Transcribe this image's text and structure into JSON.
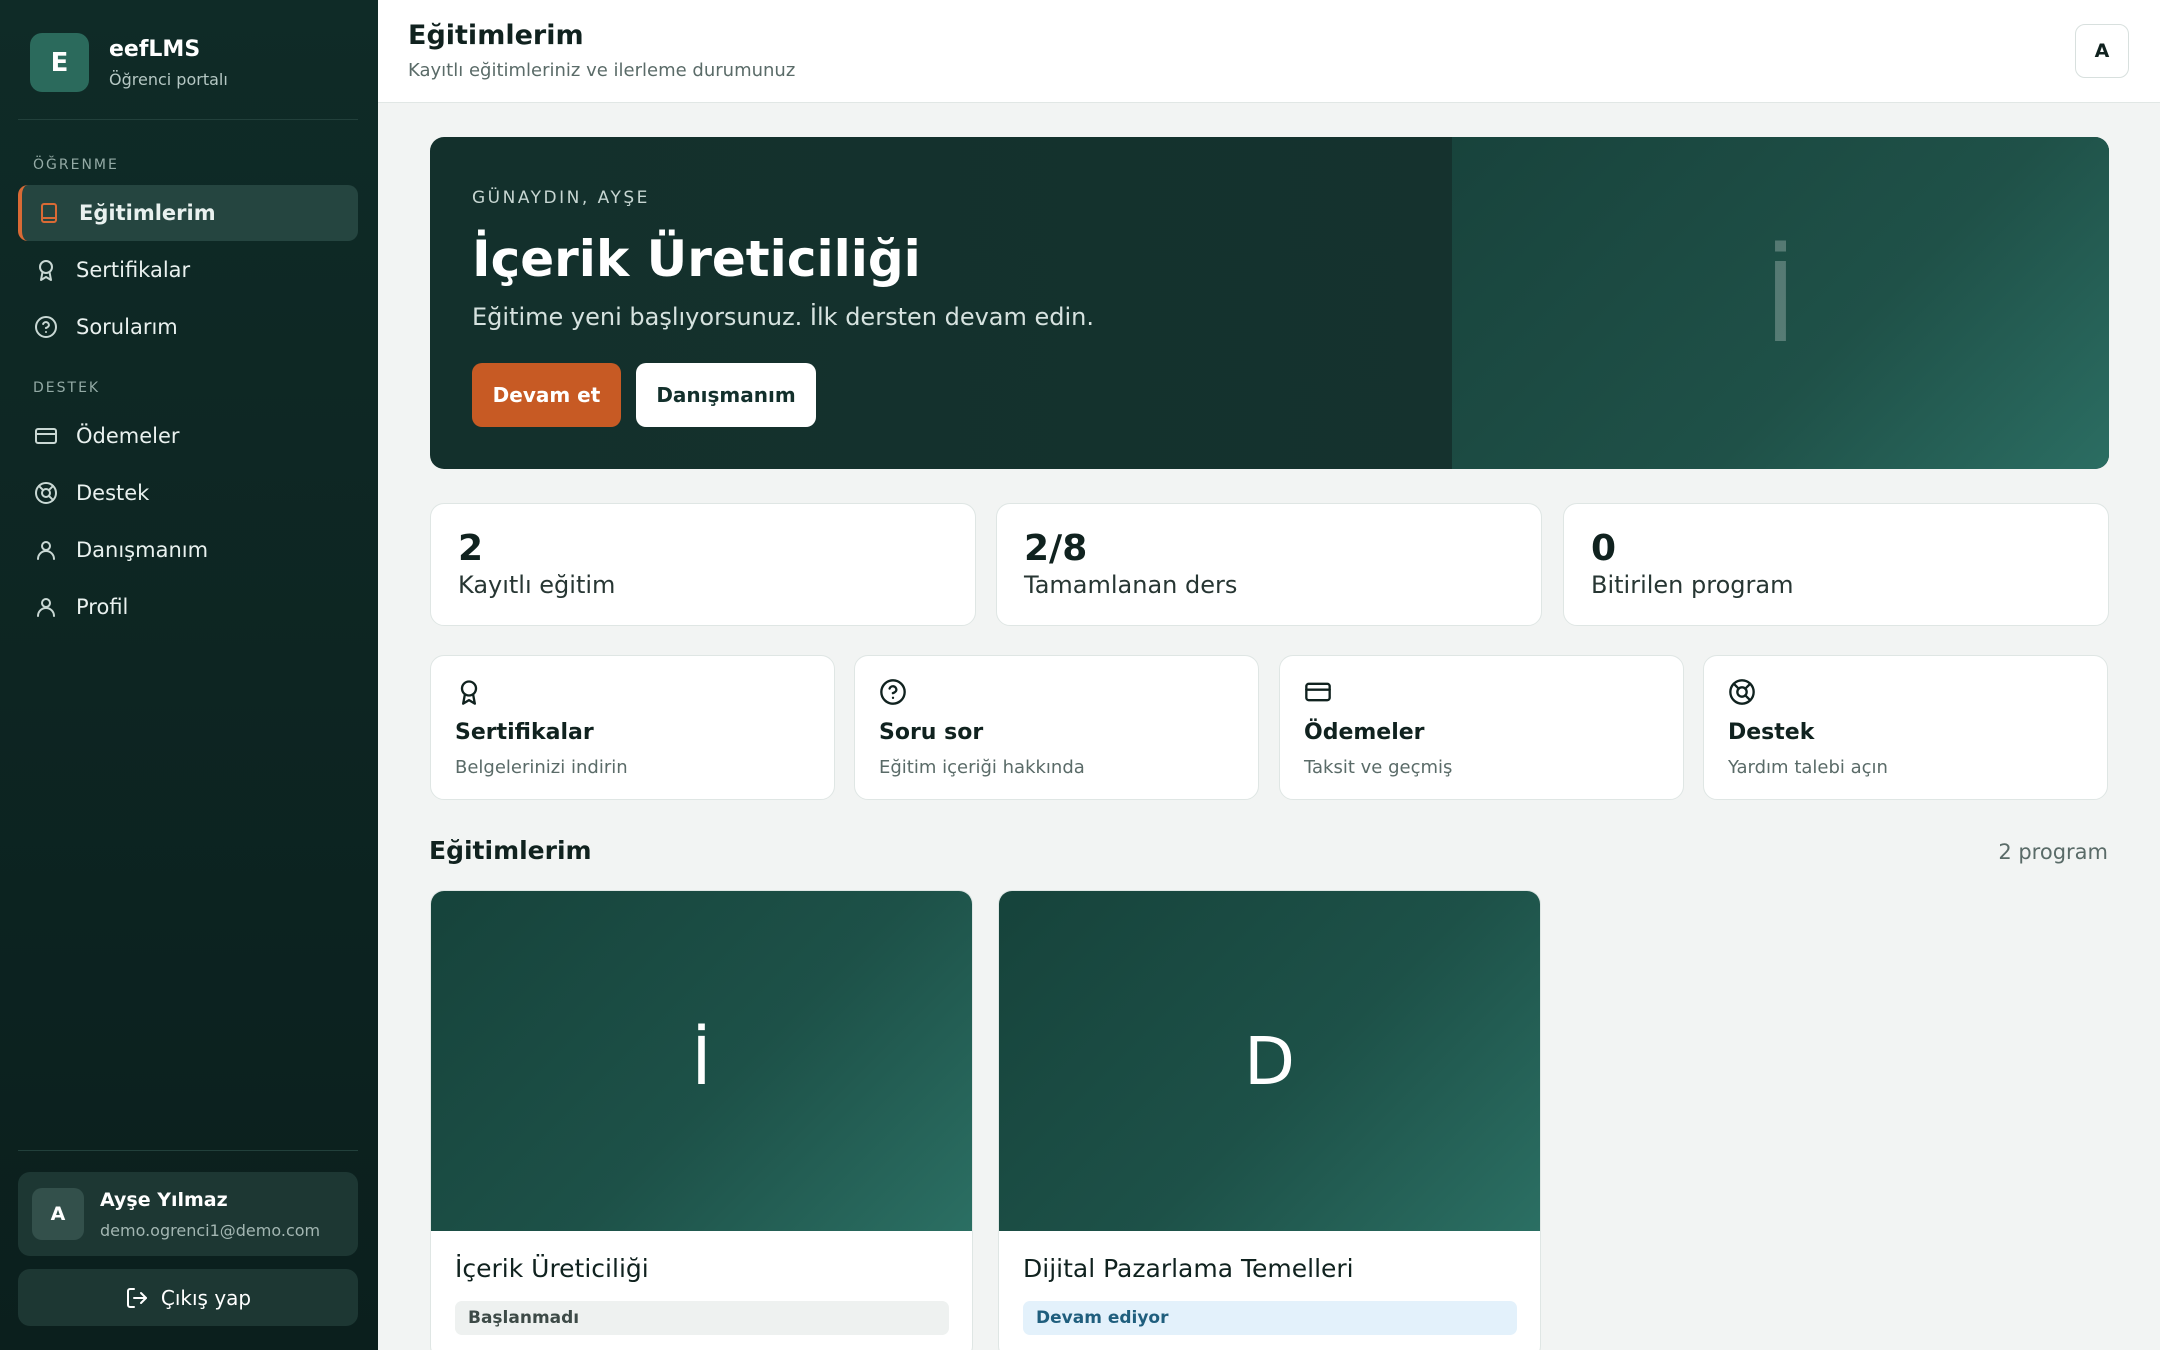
{
  "brand": {
    "logo_letter": "E",
    "name": "eefLMS",
    "subtitle": "Öğrenci portalı"
  },
  "sidebar": {
    "sections": [
      {
        "label": "ÖĞRENME"
      },
      {
        "label": "DESTEK"
      }
    ],
    "items": [
      {
        "label": "Eğitimlerim",
        "icon": "book-icon",
        "active": true
      },
      {
        "label": "Sertifikalar",
        "icon": "award-icon"
      },
      {
        "label": "Sorularım",
        "icon": "question-circle-icon"
      },
      {
        "label": "Ödemeler",
        "icon": "credit-card-icon"
      },
      {
        "label": "Destek",
        "icon": "life-buoy-icon"
      },
      {
        "label": "Danışmanım",
        "icon": "user-icon"
      },
      {
        "label": "Profil",
        "icon": "user-icon"
      }
    ]
  },
  "user": {
    "initial": "A",
    "name": "Ayşe Yılmaz",
    "email": "demo.ogrenci1@demo.com"
  },
  "logout_label": "Çıkış yap",
  "header": {
    "title": "Eğitimlerim",
    "subtitle": "Kayıtlı eğitimleriniz ve ilerleme durumunuz",
    "avatar": "A"
  },
  "hero": {
    "greeting": "GÜNAYDIN, AYŞE",
    "title": "İçerik Üreticiliği",
    "description": "Eğitime yeni başlıyorsunuz. İlk dersten devam edin.",
    "primary_button": "Devam et",
    "secondary_button": "Danışmanım",
    "thumb_letter": "İ"
  },
  "stats": [
    {
      "value": "2",
      "label": "Kayıtlı eğitim"
    },
    {
      "value": "2/8",
      "label": "Tamamlanan ders"
    },
    {
      "value": "0",
      "label": "Bitirilen program"
    }
  ],
  "quick_links": [
    {
      "title": "Sertifikalar",
      "subtitle": "Belgelerinizi indirin",
      "icon": "award-icon"
    },
    {
      "title": "Soru sor",
      "subtitle": "Eğitim içeriği hakkında",
      "icon": "question-circle-icon"
    },
    {
      "title": "Ödemeler",
      "subtitle": "Taksit ve geçmiş",
      "icon": "credit-card-icon"
    },
    {
      "title": "Destek",
      "subtitle": "Yardım talebi açın",
      "icon": "life-buoy-icon"
    }
  ],
  "courses_section": {
    "title": "Eğitimlerim",
    "count": "2 program"
  },
  "courses": [
    {
      "letter": "İ",
      "title": "İçerik Üreticiliği",
      "status": "Başlanmadı",
      "status_bg": "#eef1f0",
      "status_color": "#3d4a47"
    },
    {
      "letter": "D",
      "title": "Dijital Pazarlama Temelleri",
      "status": "Devam ediyor",
      "status_bg": "#e3f1fb",
      "status_color": "#1f5e7d"
    }
  ],
  "colors": {
    "accent": "#c75a24",
    "sidebar_bg": "#0f2b27",
    "hero_bg": "#13302c"
  }
}
